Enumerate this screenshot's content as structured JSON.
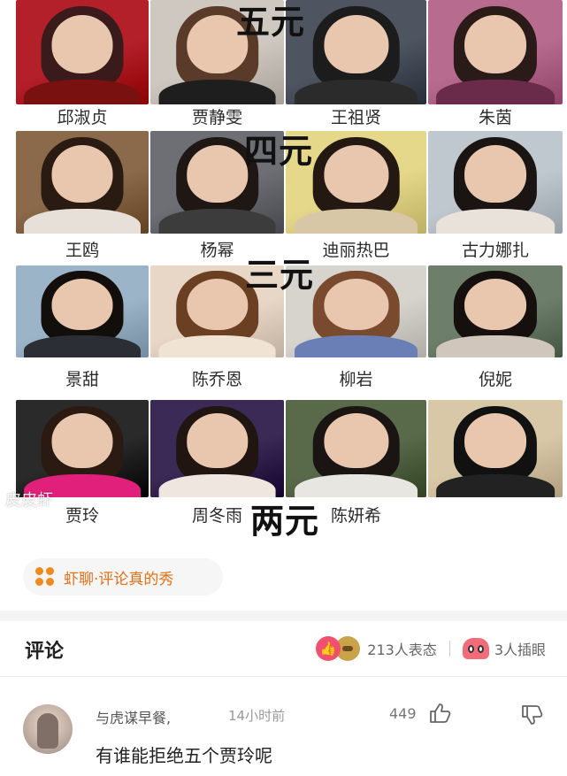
{
  "grid": {
    "names": [
      [
        "邱淑贞",
        "贾静雯",
        "王祖贤",
        "朱茵"
      ],
      [
        "王鸥",
        "杨幂",
        "迪丽热巴",
        "古力娜扎"
      ],
      [
        "景甜",
        "陈乔恩",
        "柳岩",
        "倪妮"
      ],
      [
        "贾玲",
        "周冬雨",
        "陈妍希",
        ""
      ]
    ],
    "prices": [
      "五元",
      "四元",
      "三元",
      "两元"
    ],
    "watermark": "皮皮虾"
  },
  "topic": {
    "label": "虾聊·评论真的秀",
    "icon": "flower-icon",
    "color": "#f08a20"
  },
  "comments_header": {
    "title": "评论",
    "reactions_label": "213人表态",
    "peek_label": "3人插眼"
  },
  "comment": {
    "user": "与虎谋早餐,",
    "time": "14小时前",
    "likes": "449",
    "text": "有谁能拒绝五个贾玲呢"
  }
}
